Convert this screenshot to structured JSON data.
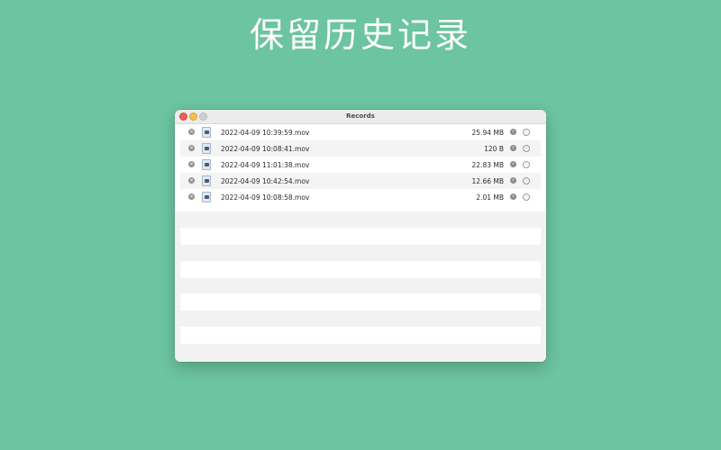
{
  "headline": "保留历史记录",
  "window": {
    "title": "Records",
    "controls": {
      "close": "close-button",
      "minimize": "minimize-button",
      "zoom": "zoom-button"
    }
  },
  "records": [
    {
      "name": "2022-04-09 10:39:59.mov",
      "size": "25.94 MB"
    },
    {
      "name": "2022-04-09 10:08:41.mov",
      "size": "120 B"
    },
    {
      "name": "2022-04-09 11:01:38.mov",
      "size": "22.83 MB"
    },
    {
      "name": "2022-04-09 10:42:54.mov",
      "size": "12.66 MB"
    },
    {
      "name": "2022-04-09 10:08:58.mov",
      "size": "2.01 MB"
    }
  ],
  "icons": {
    "remove": "remove-icon",
    "file": "video-file-icon",
    "reveal": "magnifier-icon",
    "open": "arrow-circle-icon"
  },
  "colors": {
    "background": "#6cc4a1",
    "close": "#ee5f57",
    "minimize": "#f5be4f",
    "zoom": "#d0d0d0"
  }
}
